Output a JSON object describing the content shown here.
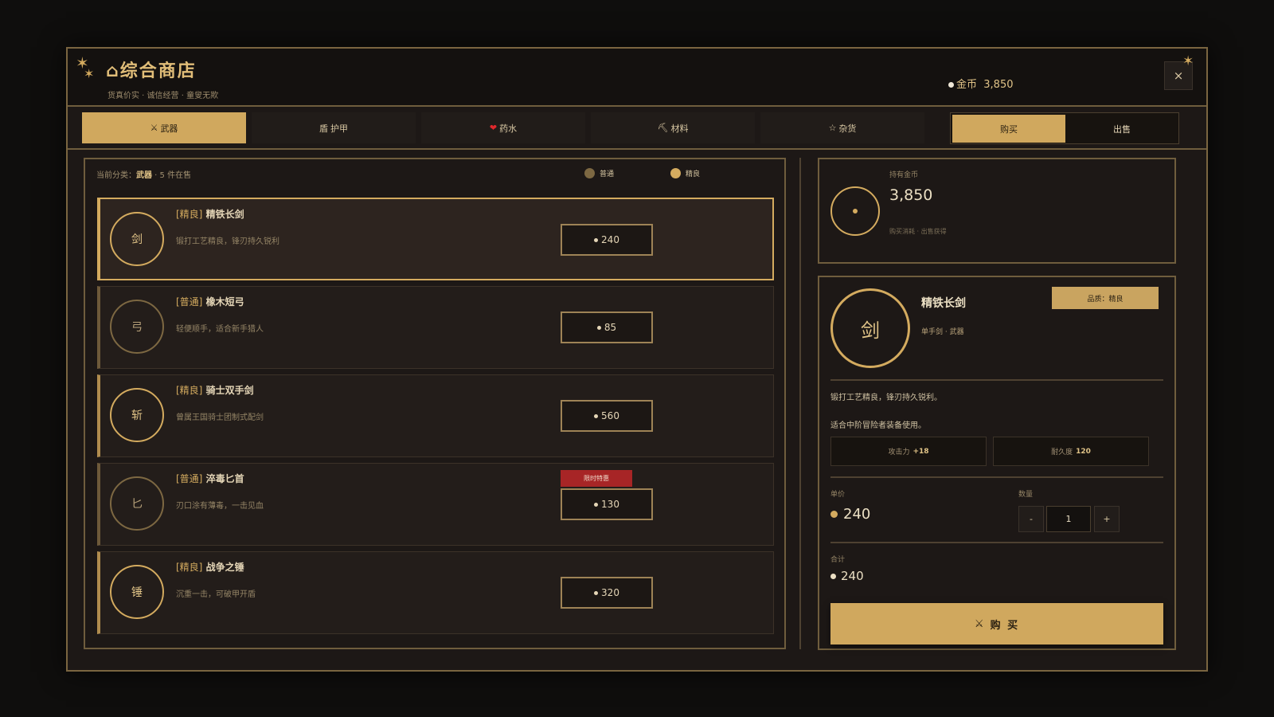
{
  "header": {
    "title": "⌂综合商店",
    "subtitle": "货真价实 · 诚信经营 · 童叟无欺",
    "gold_label": "金币",
    "gold_amount": "3,850",
    "close_label": "×"
  },
  "tabs": [
    {
      "icon": "⚔",
      "label": "武器",
      "active": true
    },
    {
      "icon": "盾",
      "label": "护甲",
      "active": false
    },
    {
      "icon": "❤",
      "label": "药水",
      "active": false
    },
    {
      "icon": "⛏",
      "label": "材料",
      "active": false
    },
    {
      "icon": "☆",
      "label": "杂货",
      "active": false
    }
  ],
  "mode": {
    "buy_label": "购买",
    "sell_label": "出售",
    "active": "buy"
  },
  "list": {
    "category_prefix": "当前分类：",
    "category_name": "武器",
    "category_suffix": " · 5 件在售",
    "legend": [
      {
        "label": "普通",
        "color": "#7d6842"
      },
      {
        "label": "精良",
        "color": "#d4ab5f"
      }
    ],
    "items": [
      {
        "glyph": "剑",
        "rarity": "[精良]",
        "name": "精铁长剑",
        "desc": "锻打工艺精良，锋刃持久锐利",
        "price": "240",
        "quality": "fine",
        "selected": true,
        "badge": ""
      },
      {
        "glyph": "弓",
        "rarity": "[普通]",
        "name": "橡木短弓",
        "desc": "轻便顺手，适合新手猎人",
        "price": "85",
        "quality": "common",
        "selected": false,
        "badge": ""
      },
      {
        "glyph": "斩",
        "rarity": "[精良]",
        "name": "骑士双手剑",
        "desc": "曾属王国骑士团制式配剑",
        "price": "560",
        "quality": "fine",
        "selected": false,
        "badge": ""
      },
      {
        "glyph": "匕",
        "rarity": "[普通]",
        "name": "淬毒匕首",
        "desc": "刃口涂有薄毒，一击见血",
        "price": "130",
        "quality": "common",
        "selected": false,
        "badge": "限时特惠"
      },
      {
        "glyph": "锤",
        "rarity": "[精良]",
        "name": "战争之锤",
        "desc": "沉重一击，可破甲开盾",
        "price": "320",
        "quality": "fine",
        "selected": false,
        "badge": ""
      }
    ]
  },
  "wallet": {
    "label": "持有金币",
    "amount": "3,850",
    "note": "购买消耗 · 出售获得"
  },
  "detail": {
    "glyph": "剑",
    "name": "精铁长剑",
    "type": "单手剑 · 武器",
    "quality_badge": "品质：精良",
    "desc_line1": "锻打工艺精良，锋刃持久锐利。",
    "desc_line2": "适合中阶冒险者装备使用。",
    "stats": [
      {
        "label": "攻击力",
        "value": "+18"
      },
      {
        "label": "耐久度",
        "value": "120"
      }
    ],
    "unit_price_label": "单价",
    "unit_price": "240",
    "quantity_label": "数量",
    "quantity": "1",
    "minus_label": "-",
    "plus_label": "+",
    "total_label": "合计",
    "total": "240",
    "buy_icon": "⚔",
    "buy_label": "购 买"
  },
  "colors": {
    "accent": "#d0a85e",
    "panel_border": "#6f5d3d",
    "promo": "#a72526"
  }
}
